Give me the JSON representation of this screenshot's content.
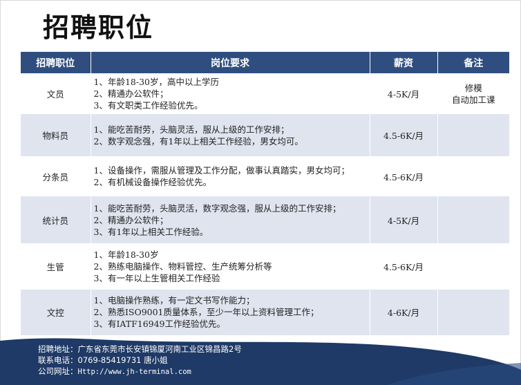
{
  "page": {
    "title": "招聘职位"
  },
  "table": {
    "headers": [
      "招聘职位",
      "岗位要求",
      "薪资",
      "备注"
    ],
    "rows": [
      {
        "position": "文员",
        "requirements": [
          "1、年龄18-30岁，高中以上学历",
          "2、精通办公软件；",
          "3、有文职类工作经验优先。"
        ],
        "salary": "4-5K/月",
        "note": [
          "修模",
          "自动加工课"
        ]
      },
      {
        "position": "物料员",
        "requirements": [
          "1、能吃苦耐劳，头脑灵活，服从上级的工作安排；",
          "2、数字观念强，有1年以上相关工作经验，男女均可。"
        ],
        "salary": "4.5-6K/月",
        "note": []
      },
      {
        "position": "分条员",
        "requirements": [
          "1、设备操作，需服从管理及工作分配，做事认真踏实，男女均可；",
          "2、有机械设备操作经验优先。"
        ],
        "salary": "4.5-6K/月",
        "note": []
      },
      {
        "position": "统计员",
        "requirements": [
          "1、能吃苦耐劳，头脑灵活，数字观念强，服从上级的工作安排；",
          "2、精通办公软件；",
          "3、有1年以上相关工作经验。"
        ],
        "salary": "4-5K/月",
        "note": []
      },
      {
        "position": "生管",
        "requirements": [
          "1、年龄18-30岁",
          "2、熟练电脑操作、物料管控、生产统筹分析等",
          "3、有一年以上生管相关工作经验"
        ],
        "salary": "4.5-6K/月",
        "note": []
      },
      {
        "position": "文控",
        "requirements": [
          "1、电脑操作熟练，有一定文书写作能力；",
          "2、熟悉ISO9001质量体系，至少一年以上资料管理工作；",
          "3、有IATF16949工作经验优先。"
        ],
        "salary": "4-6K/月",
        "note": []
      }
    ]
  },
  "footer": {
    "address": "招聘地址：广东省东莞市长安镇锦厦河南工业区锦昌路2号",
    "phone": "联系电话：0769-85419731 唐小姐",
    "website_label": "公司网址：",
    "website": "Http://www.jh-terminal.com"
  },
  "colors": {
    "header_bg": "#2f4e7f",
    "row_alt_bg": "#dfe4ef",
    "footer_bg": "#1f3a66"
  }
}
